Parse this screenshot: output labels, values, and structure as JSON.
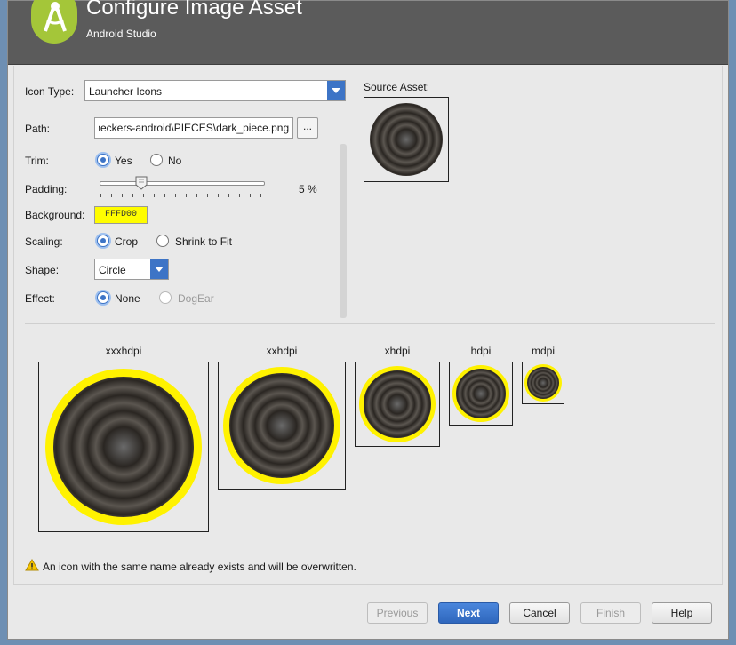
{
  "header": {
    "title": "Configure Image Asset",
    "subtitle": "Android Studio"
  },
  "form": {
    "icon_type_label": "Icon Type:",
    "icon_type_value": "Launcher Icons",
    "path_label": "Path:",
    "path_value": "\\checkers-android\\PIECES\\dark_piece.png",
    "browse_label": "...",
    "trim_label": "Trim:",
    "trim_yes": "Yes",
    "trim_no": "No",
    "padding_label": "Padding:",
    "padding_value": "5 %",
    "padding_percent": 5,
    "background_label": "Background:",
    "background_value": "FFFD00",
    "background_color": "#FFFD00",
    "scaling_label": "Scaling:",
    "scaling_crop": "Crop",
    "scaling_shrink": "Shrink to Fit",
    "shape_label": "Shape:",
    "shape_value": "Circle",
    "effect_label": "Effect:",
    "effect_none": "None",
    "effect_dogear": "DogEar"
  },
  "source": {
    "label": "Source Asset:"
  },
  "previews": [
    {
      "label": "xxxhdpi"
    },
    {
      "label": "xxhdpi"
    },
    {
      "label": "xhdpi"
    },
    {
      "label": "hdpi"
    },
    {
      "label": "mdpi"
    }
  ],
  "warning": {
    "text": "An icon with the same name already exists and will be overwritten."
  },
  "footer": {
    "previous": "Previous",
    "next": "Next",
    "cancel": "Cancel",
    "finish": "Finish",
    "help": "Help"
  },
  "colors": {
    "accent": "#3D74C6",
    "header_bg": "#5B5B5B",
    "ring": "#FFF200",
    "logo": "#A4C639"
  }
}
